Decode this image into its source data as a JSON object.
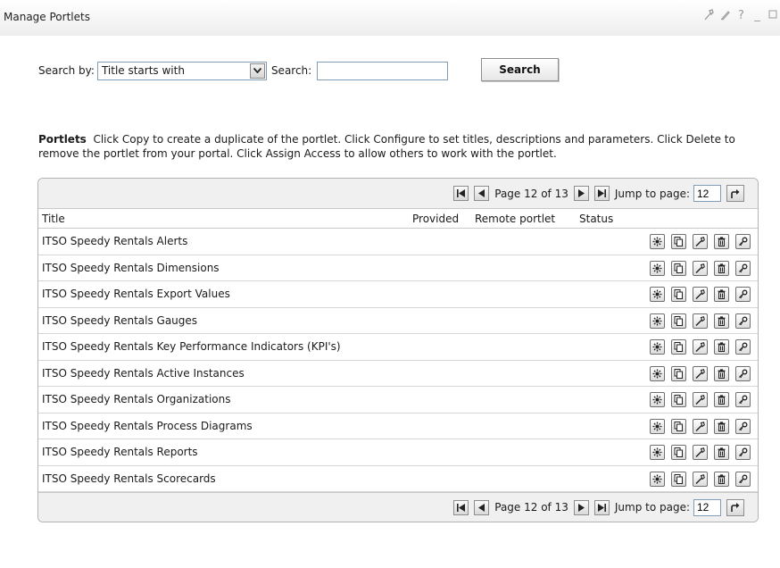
{
  "window": {
    "title": "Manage Portlets",
    "controls": [
      "wrench-icon",
      "pencil-icon",
      "help",
      "minimize",
      "maximize"
    ],
    "help_label": "?",
    "minimize_label": "_"
  },
  "search": {
    "by_label": "Search by:",
    "by_value": "Title starts with",
    "search_label": "Search:",
    "search_value": "",
    "button": "Search"
  },
  "description": {
    "heading": "Portlets",
    "text": "Click Copy to create a duplicate of the portlet. Click Configure to set titles, descriptions and parameters. Click Delete to remove the portlet from your portal. Click Assign Access to allow others to work with the portlet."
  },
  "pager": {
    "text": "Page 12 of 13",
    "jump_label": "Jump to page:",
    "jump_value": "12"
  },
  "table": {
    "columns": [
      "Title",
      "Provided",
      "Remote portlet",
      "Status"
    ],
    "rows": [
      "ITSO Speedy Rentals Alerts",
      "ITSO Speedy Rentals Dimensions",
      "ITSO Speedy Rentals Export Values",
      "ITSO Speedy Rentals Gauges",
      "ITSO Speedy Rentals Key Performance Indicators (KPI's)",
      "ITSO Speedy Rentals Active Instances",
      "ITSO Speedy Rentals Organizations",
      "ITSO Speedy Rentals Process Diagrams",
      "ITSO Speedy Rentals Reports",
      "ITSO Speedy Rentals Scorecards"
    ],
    "row_actions": [
      "settings-icon",
      "copy-icon",
      "configure-wrench-icon",
      "delete-trash-icon",
      "assign-access-key-icon"
    ]
  },
  "colors": {
    "header_gradient_end": "#eeeeee",
    "grid_border": "#b3b3b3",
    "pager_bg": "#f0f0f0",
    "input_border": "#7f9db9"
  }
}
